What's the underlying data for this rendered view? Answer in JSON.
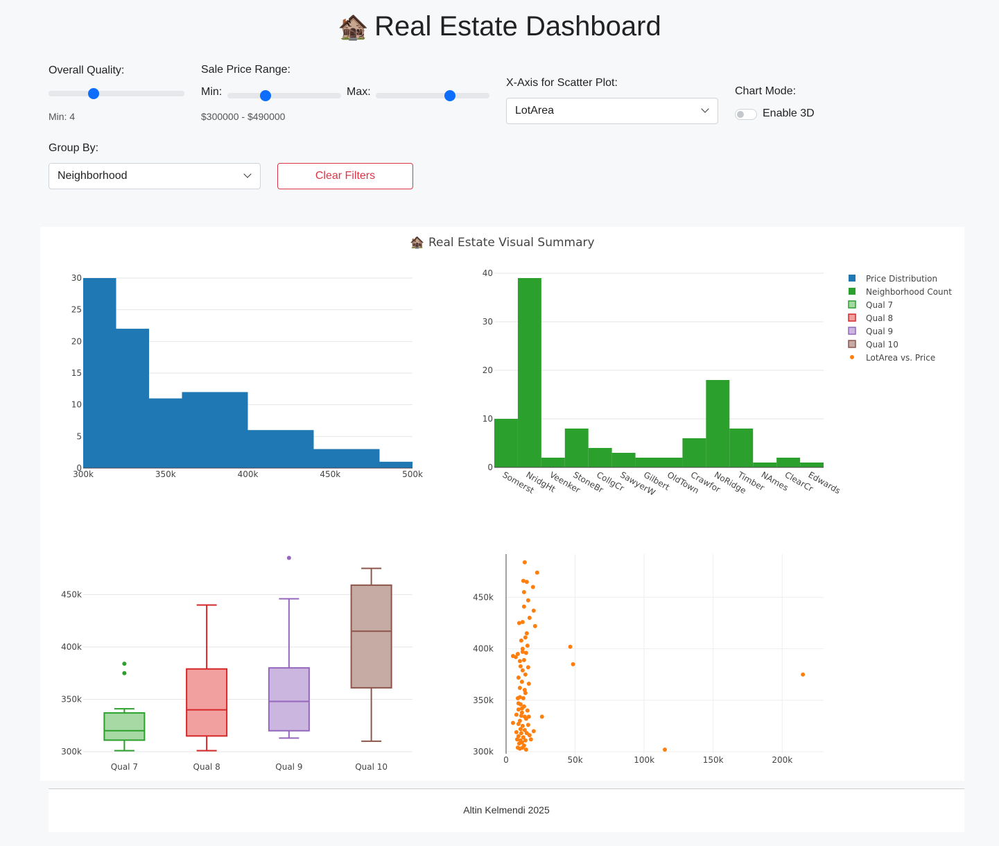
{
  "page": {
    "title_icon": "🏚️",
    "title": "Real Estate Dashboard"
  },
  "controls": {
    "quality": {
      "label": "Overall Quality:",
      "value": 4,
      "min": 1,
      "max": 10,
      "display": "Min: 4"
    },
    "price_range": {
      "label": "Sale Price Range:",
      "min_label": "Min:",
      "max_label": "Max:",
      "range_min": 100000,
      "range_max": 700000,
      "min_value": 300000,
      "max_value": 490000,
      "display": "$300000 - $490000"
    },
    "xaxis": {
      "label": "X-Axis for Scatter Plot:",
      "selected": "LotArea"
    },
    "chart_mode": {
      "label": "Chart Mode:",
      "toggle_label": "Enable 3D",
      "enabled": false
    },
    "group_by": {
      "label": "Group By:",
      "selected": "Neighborhood"
    },
    "clear_button": "Clear Filters"
  },
  "summary": {
    "title_icon": "🏚️",
    "title": "Real Estate Visual Summary"
  },
  "legend": {
    "items": [
      {
        "label": "Price Distribution",
        "color": "#1f77b4",
        "kind": "square"
      },
      {
        "label": "Neighborhood Count",
        "color": "#2ca02c",
        "kind": "square"
      },
      {
        "label": "Qual 7",
        "color": "#2ca02c",
        "fill": "#a6d9a3",
        "kind": "box"
      },
      {
        "label": "Qual 8",
        "color": "#d62728",
        "fill": "#f2a09f",
        "kind": "box"
      },
      {
        "label": "Qual 9",
        "color": "#9467bd",
        "fill": "#cbb6e0",
        "kind": "box"
      },
      {
        "label": "Qual 10",
        "color": "#8c564b",
        "fill": "#c6aaa4",
        "kind": "box"
      },
      {
        "label": "LotArea vs. Price",
        "color": "#ff7f0e",
        "kind": "dot"
      }
    ]
  },
  "chart_data": [
    {
      "type": "bar",
      "subtype": "histogram",
      "name": "Price Distribution",
      "color": "#1f77b4",
      "bins": [
        {
          "x0": 300000,
          "x1": 320000,
          "count": 30
        },
        {
          "x0": 320000,
          "x1": 340000,
          "count": 22
        },
        {
          "x0": 340000,
          "x1": 360000,
          "count": 11
        },
        {
          "x0": 360000,
          "x1": 380000,
          "count": 12
        },
        {
          "x0": 380000,
          "x1": 400000,
          "count": 12
        },
        {
          "x0": 400000,
          "x1": 420000,
          "count": 6
        },
        {
          "x0": 420000,
          "x1": 440000,
          "count": 6
        },
        {
          "x0": 440000,
          "x1": 460000,
          "count": 3
        },
        {
          "x0": 460000,
          "x1": 480000,
          "count": 3
        },
        {
          "x0": 480000,
          "x1": 500000,
          "count": 1
        }
      ],
      "xlim": [
        300000,
        500000
      ],
      "ylim": [
        0,
        30
      ],
      "xticks": [
        {
          "v": 300000,
          "label": "300k"
        },
        {
          "v": 350000,
          "label": "350k"
        },
        {
          "v": 400000,
          "label": "400k"
        },
        {
          "v": 450000,
          "label": "450k"
        },
        {
          "v": 500000,
          "label": "500k"
        }
      ],
      "yticks": [
        0,
        5,
        10,
        15,
        20,
        25,
        30
      ]
    },
    {
      "type": "bar",
      "name": "Neighborhood Count",
      "color": "#2ca02c",
      "categories": [
        "Somerst",
        "NridgHt",
        "Veenker",
        "StoneBr",
        "CollgCr",
        "SawyerW",
        "Gilbert",
        "OldTown",
        "Crawfor",
        "NoRidge",
        "Timber",
        "NAmes",
        "ClearCr",
        "Edwards"
      ],
      "values": [
        10,
        39,
        2,
        8,
        4,
        3,
        2,
        2,
        6,
        18,
        8,
        1,
        2,
        1
      ],
      "ylim": [
        0,
        40
      ],
      "yticks": [
        0,
        10,
        20,
        30,
        40
      ]
    },
    {
      "type": "box",
      "categories": [
        "Qual 7",
        "Qual 8",
        "Qual 9",
        "Qual 10"
      ],
      "series": [
        {
          "name": "Qual 7",
          "color": "#2ca02c",
          "fill": "#a6d9a3",
          "lower_fence": 301000,
          "q1": 311000,
          "median": 320000,
          "q3": 337000,
          "upper_fence": 341000,
          "outliers": [
            375000,
            384000
          ]
        },
        {
          "name": "Qual 8",
          "color": "#d62728",
          "fill": "#f2a09f",
          "lower_fence": 301000,
          "q1": 315000,
          "median": 340000,
          "q3": 379000,
          "upper_fence": 440000,
          "outliers": []
        },
        {
          "name": "Qual 9",
          "color": "#9467bd",
          "fill": "#cbb6e0",
          "lower_fence": 313000,
          "q1": 320000,
          "median": 348000,
          "q3": 380000,
          "upper_fence": 446000,
          "outliers": [
            485000
          ]
        },
        {
          "name": "Qual 10",
          "color": "#8c564b",
          "fill": "#c6aaa4",
          "lower_fence": 310000,
          "q1": 361000,
          "median": 415000,
          "q3": 459000,
          "upper_fence": 475000,
          "outliers": []
        }
      ],
      "ylim": [
        300000,
        490000
      ],
      "yticks": [
        {
          "v": 300000,
          "label": "300k"
        },
        {
          "v": 350000,
          "label": "350k"
        },
        {
          "v": 400000,
          "label": "400k"
        },
        {
          "v": 450000,
          "label": "450k"
        }
      ]
    },
    {
      "type": "scatter",
      "name": "LotArea vs. Price",
      "color": "#ff7f0e",
      "points": [
        [
          13500,
          484000
        ],
        [
          22500,
          474000
        ],
        [
          12500,
          466000
        ],
        [
          15000,
          465000
        ],
        [
          19500,
          460000
        ],
        [
          13000,
          455000
        ],
        [
          16000,
          447000
        ],
        [
          13000,
          441000
        ],
        [
          20000,
          437000
        ],
        [
          17000,
          430000
        ],
        [
          9500,
          425000
        ],
        [
          12000,
          426000
        ],
        [
          21000,
          422000
        ],
        [
          15000,
          415000
        ],
        [
          14000,
          411000
        ],
        [
          11000,
          408000
        ],
        [
          15500,
          403000
        ],
        [
          12000,
          400000
        ],
        [
          46500,
          402000
        ],
        [
          8500,
          395000
        ],
        [
          12000,
          397000
        ],
        [
          14500,
          396000
        ],
        [
          5000,
          393000
        ],
        [
          7000,
          392000
        ],
        [
          10000,
          388000
        ],
        [
          13000,
          389000
        ],
        [
          48500,
          385000
        ],
        [
          10500,
          383000
        ],
        [
          16000,
          382000
        ],
        [
          12000,
          379000
        ],
        [
          14000,
          375000
        ],
        [
          9000,
          372000
        ],
        [
          215000,
          375000
        ],
        [
          11500,
          368000
        ],
        [
          16500,
          366000
        ],
        [
          10000,
          362000
        ],
        [
          14000,
          357000
        ],
        [
          8500,
          352000
        ],
        [
          12500,
          352000
        ],
        [
          10500,
          346000
        ],
        [
          13000,
          344000
        ],
        [
          9000,
          341000
        ],
        [
          11500,
          338000
        ],
        [
          15500,
          340000
        ],
        [
          7500,
          336000
        ],
        [
          11000,
          335000
        ],
        [
          13500,
          334000
        ],
        [
          26000,
          334000
        ],
        [
          10000,
          330000
        ],
        [
          14500,
          332000
        ],
        [
          5000,
          328000
        ],
        [
          9000,
          327000
        ],
        [
          12000,
          325000
        ],
        [
          16000,
          326000
        ],
        [
          10500,
          322000
        ],
        [
          13500,
          321000
        ],
        [
          7500,
          319000
        ],
        [
          11000,
          318000
        ],
        [
          15000,
          318000
        ],
        [
          9000,
          315000
        ],
        [
          12500,
          314000
        ],
        [
          17000,
          316000
        ],
        [
          8000,
          312000
        ],
        [
          10500,
          311000
        ],
        [
          14000,
          311000
        ],
        [
          11500,
          309000
        ],
        [
          9500,
          308000
        ],
        [
          13000,
          306000
        ],
        [
          10000,
          303000
        ],
        [
          12000,
          304000
        ],
        [
          14500,
          302000
        ],
        [
          8500,
          304000
        ],
        [
          115000,
          302000
        ],
        [
          20000,
          320000
        ],
        [
          18000,
          312000
        ],
        [
          16500,
          334000
        ],
        [
          9000,
          347000
        ],
        [
          11500,
          342000
        ],
        [
          13500,
          360000
        ],
        [
          10000,
          353000
        ]
      ],
      "xlim": [
        0,
        230000
      ],
      "ylim": [
        298000,
        492000
      ],
      "xticks": [
        {
          "v": 0,
          "label": "0"
        },
        {
          "v": 50000,
          "label": "50k"
        },
        {
          "v": 100000,
          "label": "100k"
        },
        {
          "v": 150000,
          "label": "150k"
        },
        {
          "v": 200000,
          "label": "200k"
        }
      ],
      "yticks": [
        {
          "v": 300000,
          "label": "300k"
        },
        {
          "v": 350000,
          "label": "350k"
        },
        {
          "v": 400000,
          "label": "400k"
        },
        {
          "v": 450000,
          "label": "450k"
        }
      ]
    }
  ],
  "footer": {
    "text": "Altin Kelmendi 2025"
  }
}
